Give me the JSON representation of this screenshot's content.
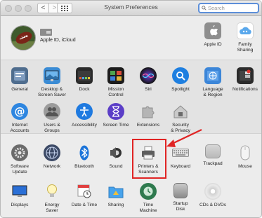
{
  "window": {
    "title": "System Preferences"
  },
  "toolbar": {
    "back": "<",
    "forward": ">"
  },
  "search": {
    "placeholder": "Search",
    "value": ""
  },
  "account": {
    "label": "Apple ID, iCloud",
    "items": [
      {
        "label": "Apple ID"
      },
      {
        "label": "Family\nSharing"
      }
    ]
  },
  "rows": [
    [
      {
        "label": "General"
      },
      {
        "label": "Desktop &\nScreen Saver"
      },
      {
        "label": "Dock"
      },
      {
        "label": "Mission\nControl"
      },
      {
        "label": "Siri"
      },
      {
        "label": "Spotlight"
      },
      {
        "label": "Language\n& Region"
      },
      {
        "label": "Notifications"
      }
    ],
    [
      {
        "label": "Internet\nAccounts"
      },
      {
        "label": "Users &\nGroups"
      },
      {
        "label": "Accessibility"
      },
      {
        "label": "Screen Time"
      },
      {
        "label": "Extensions"
      },
      {
        "label": "Security\n& Privacy"
      }
    ],
    [
      {
        "label": "Software\nUpdate"
      },
      {
        "label": "Network"
      },
      {
        "label": "Bluetooth"
      },
      {
        "label": "Sound"
      },
      {
        "label": "Printers &\nScanners"
      },
      {
        "label": "Keyboard"
      },
      {
        "label": "Trackpad"
      },
      {
        "label": "Mouse"
      }
    ],
    [
      {
        "label": "Displays"
      },
      {
        "label": "Energy\nSaver"
      },
      {
        "label": "Date & Time"
      },
      {
        "label": "Sharing"
      },
      {
        "label": "Time\nMachine"
      },
      {
        "label": "Startup\nDisk"
      },
      {
        "label": "CDs & DVDs"
      }
    ]
  ],
  "annotation": {
    "color": "#e02424",
    "target": "Printers & Scanners"
  }
}
